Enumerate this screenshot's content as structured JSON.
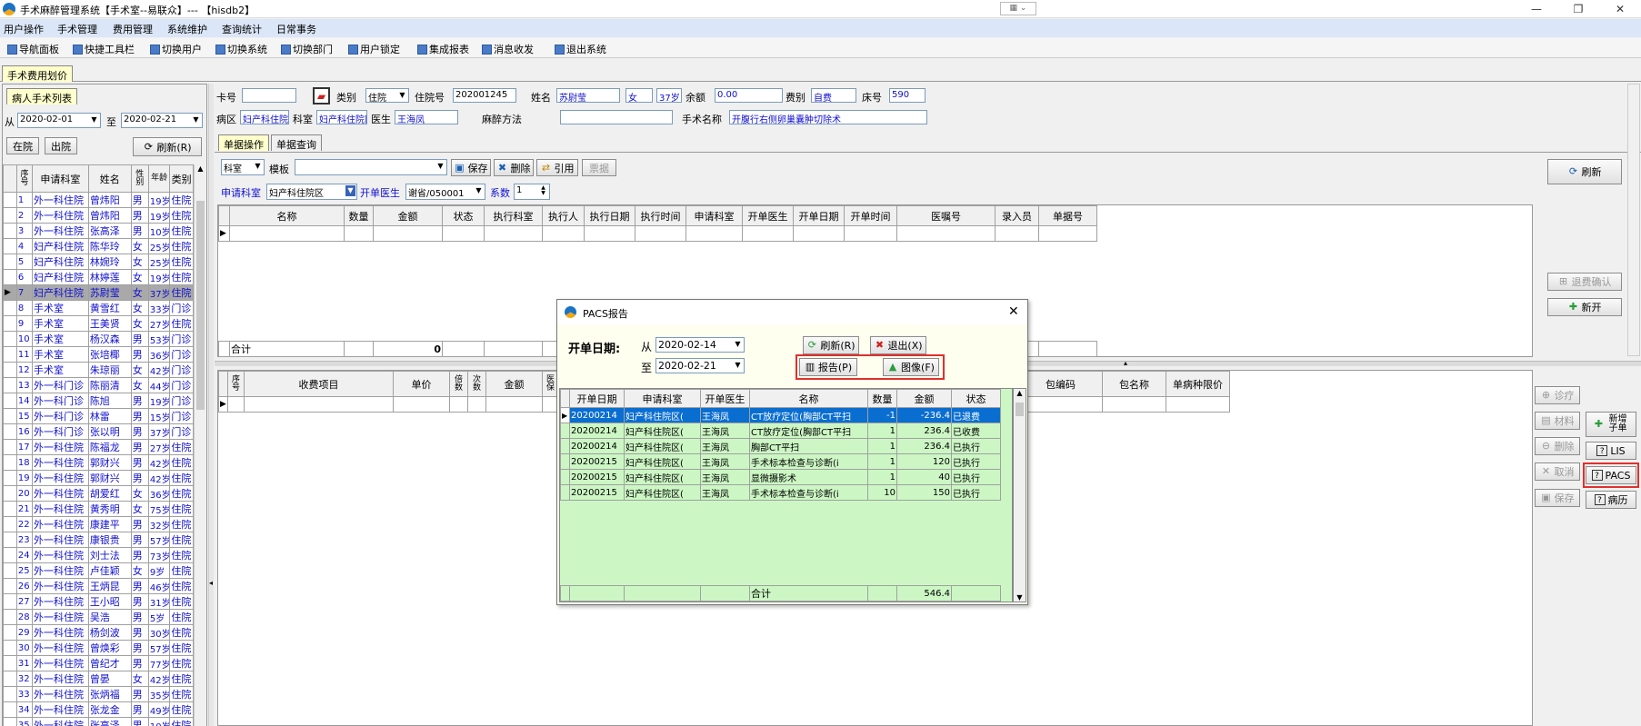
{
  "window": {
    "title": "手术麻醉管理系统【手术室--易联众】--- 【hisdb2】"
  },
  "menu": [
    "用户操作",
    "手术管理",
    "费用管理",
    "系统维护",
    "查询统计",
    "日常事务"
  ],
  "toolbar": [
    "导航面板",
    "快捷工具栏",
    "切换用户",
    "切换系统",
    "切换部门",
    "用户锁定",
    "集成报表",
    "消息收发",
    "退出系统"
  ],
  "doc_tab": "手术费用划价",
  "left": {
    "tab": "病人手术列表",
    "from_label": "从",
    "from": "2020-02-01",
    "to_label": "至",
    "to": "2020-02-21",
    "btn_inpatient": "在院",
    "btn_discharged": "出院",
    "btn_refresh": "刷新(R)",
    "headers": [
      "序号",
      "申请科室",
      "姓名",
      "性别",
      "年龄",
      "类别"
    ],
    "rows": [
      [
        "1",
        "外一科住院",
        "曾炜阳",
        "男",
        "19岁",
        "住院"
      ],
      [
        "2",
        "外一科住院",
        "曾炜阳",
        "男",
        "19岁",
        "住院"
      ],
      [
        "3",
        "外一科住院",
        "张高泽",
        "男",
        "10岁",
        "住院"
      ],
      [
        "4",
        "妇产科住院",
        "陈华玲",
        "女",
        "25岁",
        "住院"
      ],
      [
        "5",
        "妇产科住院",
        "林婉玲",
        "女",
        "25岁",
        "住院"
      ],
      [
        "6",
        "妇产科住院",
        "林婷莲",
        "女",
        "19岁",
        "住院"
      ],
      [
        "7",
        "妇产科住院",
        "苏尉莹",
        "女",
        "37岁",
        "住院"
      ],
      [
        "8",
        "手术室",
        "黄雪红",
        "女",
        "33岁",
        "门诊"
      ],
      [
        "9",
        "手术室",
        "王美贤",
        "女",
        "27岁",
        "住院"
      ],
      [
        "10",
        "手术室",
        "杨汉森",
        "男",
        "53岁",
        "门诊"
      ],
      [
        "11",
        "手术室",
        "张培椰",
        "男",
        "36岁",
        "门诊"
      ],
      [
        "12",
        "手术室",
        "朱琼丽",
        "女",
        "42岁",
        "门诊"
      ],
      [
        "13",
        "外一科门诊",
        "陈丽清",
        "女",
        "44岁",
        "门诊"
      ],
      [
        "14",
        "外一科门诊",
        "陈旭",
        "男",
        "19岁",
        "门诊"
      ],
      [
        "15",
        "外一科门诊",
        "林雷",
        "男",
        "15岁",
        "门诊"
      ],
      [
        "16",
        "外一科门诊",
        "张以明",
        "男",
        "37岁",
        "门诊"
      ],
      [
        "17",
        "外一科住院",
        "陈福龙",
        "男",
        "27岁",
        "住院"
      ],
      [
        "18",
        "外一科住院",
        "郭财兴",
        "男",
        "42岁",
        "住院"
      ],
      [
        "19",
        "外一科住院",
        "郭财兴",
        "男",
        "42岁",
        "住院"
      ],
      [
        "20",
        "外一科住院",
        "胡爱红",
        "女",
        "36岁",
        "住院"
      ],
      [
        "21",
        "外一科住院",
        "黄秀明",
        "女",
        "75岁",
        "住院"
      ],
      [
        "22",
        "外一科住院",
        "康建平",
        "男",
        "32岁",
        "住院"
      ],
      [
        "23",
        "外一科住院",
        "康银贵",
        "男",
        "57岁",
        "住院"
      ],
      [
        "24",
        "外一科住院",
        "刘士法",
        "男",
        "73岁",
        "住院"
      ],
      [
        "25",
        "外一科住院",
        "卢佳颖",
        "女",
        "9岁",
        "住院"
      ],
      [
        "26",
        "外一科住院",
        "王炳昆",
        "男",
        "46岁",
        "住院"
      ],
      [
        "27",
        "外一科住院",
        "王小昭",
        "男",
        "31岁",
        "住院"
      ],
      [
        "28",
        "外一科住院",
        "吴浩",
        "男",
        "5岁",
        "住院"
      ],
      [
        "29",
        "外一科住院",
        "杨剑波",
        "男",
        "30岁",
        "住院"
      ],
      [
        "30",
        "外一科住院",
        "曾焕彩",
        "男",
        "57岁",
        "住院"
      ],
      [
        "31",
        "外一科住院",
        "曾纪才",
        "男",
        "77岁",
        "住院"
      ],
      [
        "32",
        "外一科住院",
        "曾晏",
        "女",
        "42岁",
        "住院"
      ],
      [
        "33",
        "外一科住院",
        "张炳福",
        "男",
        "35岁",
        "住院"
      ],
      [
        "34",
        "外一科住院",
        "张龙金",
        "男",
        "49岁",
        "住院"
      ],
      [
        "35",
        "外一科住院",
        "张高泽",
        "男",
        "10岁",
        "住院"
      ]
    ]
  },
  "patient": {
    "card_label": "卡号",
    "card": "",
    "type_label": "类别",
    "type": "住院",
    "inpatient_no_label": "住院号",
    "inpatient_no": "202001245",
    "name_label": "姓名",
    "name": "苏尉莹",
    "sex": "女",
    "age": "37岁",
    "balance_label": "余额",
    "balance": "0.00",
    "fee_type_label": "费别",
    "fee_type": "自费",
    "bed_label": "床号",
    "bed": "590",
    "ward_label": "病区",
    "ward": "妇产科住院区",
    "dept_label": "科室",
    "dept": "妇产科住院区",
    "doctor_label": "医生",
    "doctor": "王海凤",
    "anesthesia_label": "麻醉方法",
    "anesthesia": "",
    "surgery_label": "手术名称",
    "surgery": "开腹行右侧卵巢囊肿切除术"
  },
  "main_tabs": [
    "单据操作",
    "单据查询"
  ],
  "form_toolbar": {
    "dept": "科室",
    "template_label": "模板",
    "save": "保存",
    "delete": "删除",
    "cite": "引用",
    "receipt": "票据"
  },
  "apply": {
    "dept_label": "申请科室",
    "dept": "妇产科住院区",
    "doctor_label": "开单医生",
    "doctor": "谢省/050001",
    "factor_label": "系数",
    "factor": "1"
  },
  "top_grid": {
    "headers": [
      "名称",
      "数量",
      "金额",
      "状态",
      "执行科室",
      "执行人",
      "执行日期",
      "执行时间",
      "申请科室",
      "开单医生",
      "开单日期",
      "开单时间",
      "医嘱号",
      "录入员",
      "单据号"
    ],
    "total_label": "合计",
    "total": "0"
  },
  "bottom_grid": {
    "headers": [
      "序号",
      "收费项目",
      "单价",
      "倍数",
      "次数",
      "金额",
      "医保"
    ],
    "headers_right": [
      "包编码",
      "包名称",
      "单病种限价"
    ]
  },
  "right_buttons": {
    "refresh": "刷新",
    "refund_confirm": "退费确认",
    "new": "新开",
    "diag": "诊疗",
    "material": "材料",
    "delete": "删除",
    "cancel": "取消",
    "save": "保存",
    "add_sub": "新增子单",
    "lis": "LIS",
    "pacs": "PACS",
    "record": "病历"
  },
  "dialog": {
    "title": "PACS报告",
    "date_label": "开单日期:",
    "from_label": "从",
    "from": "2020-02-14",
    "to_label": "至",
    "to": "2020-02-21",
    "refresh": "刷新(R)",
    "exit": "退出(X)",
    "report": "报告(P)",
    "image": "图像(F)",
    "headers": [
      "开单日期",
      "申请科室",
      "开单医生",
      "名称",
      "数量",
      "金额",
      "状态"
    ],
    "rows": [
      [
        "20200214",
        "妇产科住院区(",
        "王海凤",
        "CT放疗定位(胸部CT平扫",
        "-1",
        "-236.4",
        "已退费"
      ],
      [
        "20200214",
        "妇产科住院区(",
        "王海凤",
        "CT放疗定位(胸部CT平扫",
        "1",
        "236.4",
        "已收费"
      ],
      [
        "20200214",
        "妇产科住院区(",
        "王海凤",
        "胸部CT平扫",
        "1",
        "236.4",
        "已执行"
      ],
      [
        "20200215",
        "妇产科住院区(",
        "王海凤",
        "手术标本检查与诊断(i",
        "1",
        "120",
        "已执行"
      ],
      [
        "20200215",
        "妇产科住院区(",
        "王海凤",
        "显微摄影术",
        "1",
        "40",
        "已执行"
      ],
      [
        "20200215",
        "妇产科住院区(",
        "王海凤",
        "手术标本检查与诊断(i",
        "10",
        "150",
        "已执行"
      ]
    ],
    "total_label": "合计",
    "total": "546.4"
  }
}
